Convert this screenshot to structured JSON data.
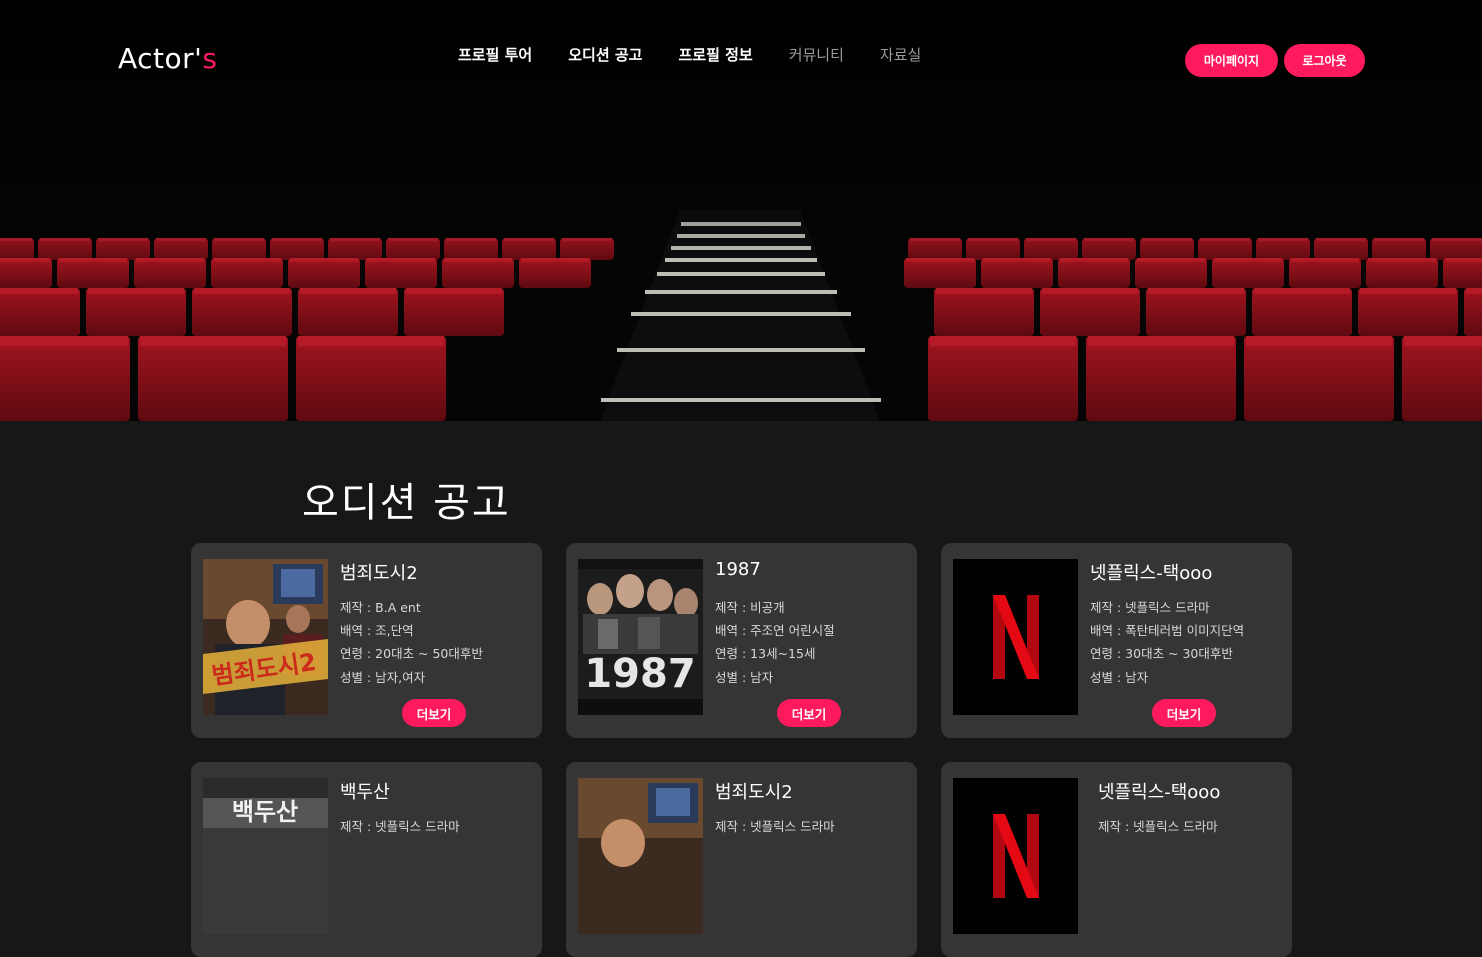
{
  "loading_progress": 0.2,
  "header": {
    "brand_main": "Actor'",
    "brand_accent": "s",
    "nav": [
      "프로필 투어",
      "오디션 공고",
      "프로필 정보",
      "커뮤니티",
      "자료실"
    ],
    "mypage_label": "마이페이지",
    "logout_label": "로그아웃"
  },
  "colors": {
    "accent": "#ff1a5e",
    "card_bg": "#353535",
    "page_bg": "#171717",
    "seat_red": "#8e1119"
  },
  "section": {
    "title": "오디션 공고"
  },
  "cards": [
    {
      "title": "범죄도시2",
      "producer": "제작 : B.A ent",
      "role": "배역 : 조,단역",
      "age": "연령 : 20대초 ~ 50대후반",
      "gender": "성별 : 남자,여자",
      "more": "더보기",
      "poster": "crime-city-poster",
      "poster_text": "범죄도시2"
    },
    {
      "title": "1987",
      "producer": "제작 : 비공개",
      "role": "배역 : 주조연 어린시절",
      "age": "연령 : 13세~15세",
      "gender": "성별 : 남자",
      "more": "더보기",
      "poster": "movie-1987-poster",
      "poster_text": "1987"
    },
    {
      "title": "넷플릭스-택ooo",
      "producer": "제작 : 넷플릭스 드라마",
      "role": "배역 : 폭탄테러범 이미지단역",
      "age": "연령 : 30대초 ~ 30대후반",
      "gender": "성별 : 남자",
      "more": "더보기",
      "poster": "netflix-poster",
      "poster_text": "N"
    },
    {
      "title": "백두산",
      "producer": "제작 : 넷플릭스 드라마",
      "poster": "baekdusan-poster",
      "poster_text": "백두산"
    },
    {
      "title": "범죄도시2",
      "producer": "제작 : 넷플릭스 드라마",
      "poster": "crime-city-poster",
      "poster_text": ""
    },
    {
      "title": "넷플릭스-택ooo",
      "producer": "제작 : 넷플릭스 드라마",
      "poster": "netflix-poster",
      "poster_text": "N"
    }
  ]
}
